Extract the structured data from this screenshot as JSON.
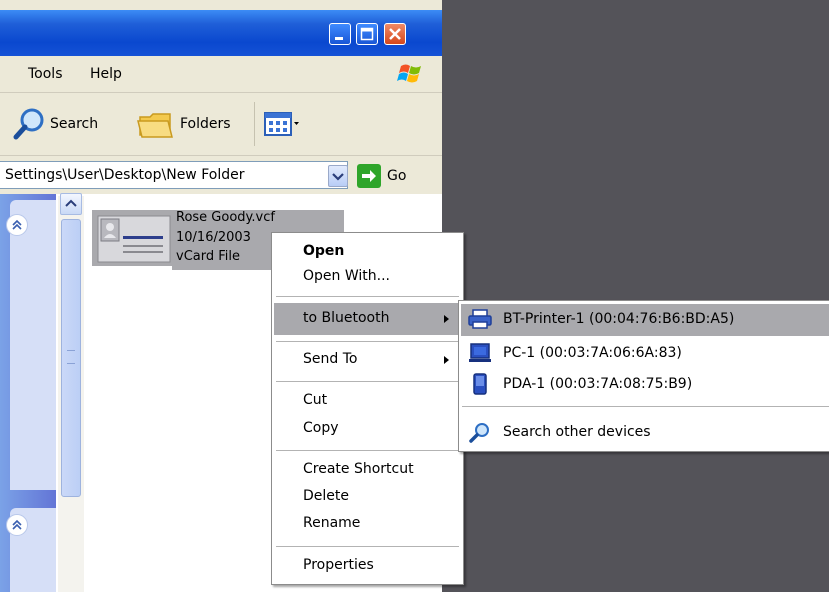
{
  "window": {
    "menu": [
      "Tools",
      "Help"
    ],
    "toolbar": {
      "search_label": "Search",
      "folders_label": "Folders"
    },
    "address": {
      "value": "Settings\\User\\Desktop\\New Folder",
      "go_label": "Go"
    }
  },
  "file": {
    "name": "Rose Goody.vcf",
    "date": "10/16/2003",
    "type": "vCard File"
  },
  "context_menu": {
    "open": "Open",
    "open_with": "Open With...",
    "to_bluetooth": "to Bluetooth",
    "send_to": "Send To",
    "cut": "Cut",
    "copy": "Copy",
    "create_shortcut": "Create Shortcut",
    "delete": "Delete",
    "rename": "Rename",
    "properties": "Properties"
  },
  "bluetooth_submenu": {
    "devices": [
      {
        "label": "BT-Printer-1 (00:04:76:B6:BD:A5)",
        "icon": "printer-icon"
      },
      {
        "label": "PC-1 (00:03:7A:06:6A:83)",
        "icon": "computer-icon"
      },
      {
        "label": "PDA-1 (00:03:7A:08:75:B9)",
        "icon": "pda-icon"
      }
    ],
    "search_other": "Search other devices"
  },
  "colors": {
    "highlight": "#a9a9ad",
    "desktop": "#545359",
    "titlebar": "#0a48cf",
    "window_bg": "#ece9d8"
  }
}
